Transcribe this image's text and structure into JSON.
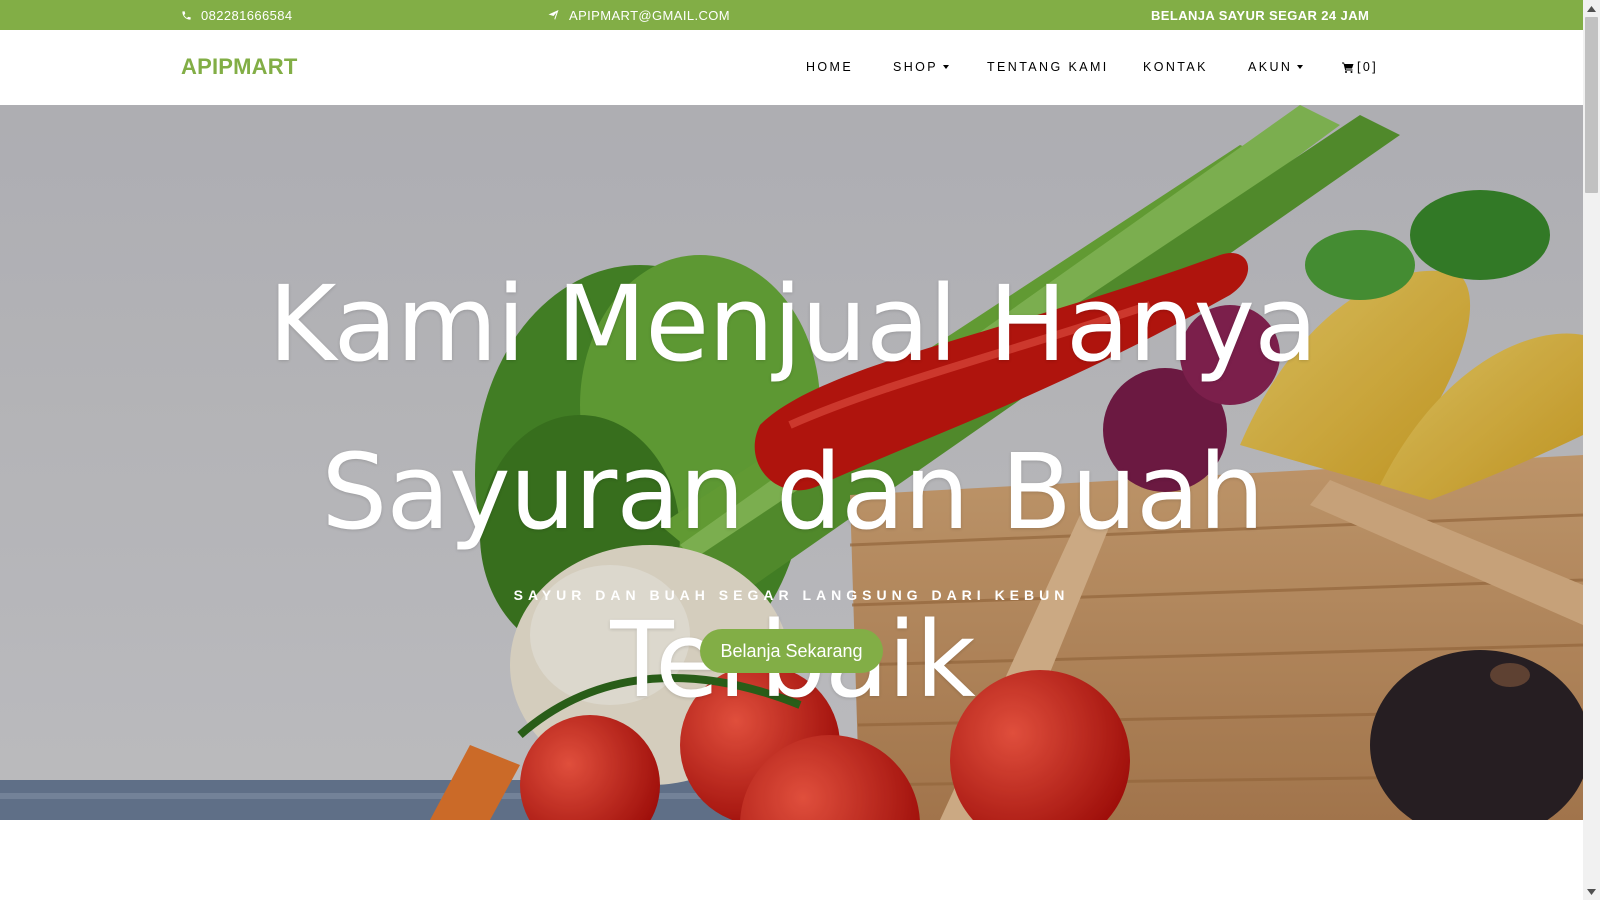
{
  "topbar": {
    "phone": "082281666584",
    "email": "APIPMART@GMAIL.COM",
    "promo": "BELANJA SAYUR SEGAR 24 JAM",
    "phone_icon": "phone-icon",
    "email_icon": "paper-plane-icon"
  },
  "navbar": {
    "brand": "APIPMART",
    "items": [
      {
        "label": "HOME"
      },
      {
        "label": "SHOP"
      },
      {
        "label": "TENTANG KAMI"
      },
      {
        "label": "KONTAK"
      },
      {
        "label": "AKUN"
      }
    ],
    "cart_count": "[0]",
    "cart_icon": "cart-icon"
  },
  "hero": {
    "title": "Kami Menjual Hanya Sayuran dan Buah Terbaik",
    "subtitle": "SAYUR DAN BUAH SEGAR LANGSUNG DARI KEBUN",
    "button": "Belanja Sekarang"
  },
  "colors": {
    "brand_green": "#82ae46",
    "white": "#ffffff",
    "text_dark": "#000000"
  }
}
